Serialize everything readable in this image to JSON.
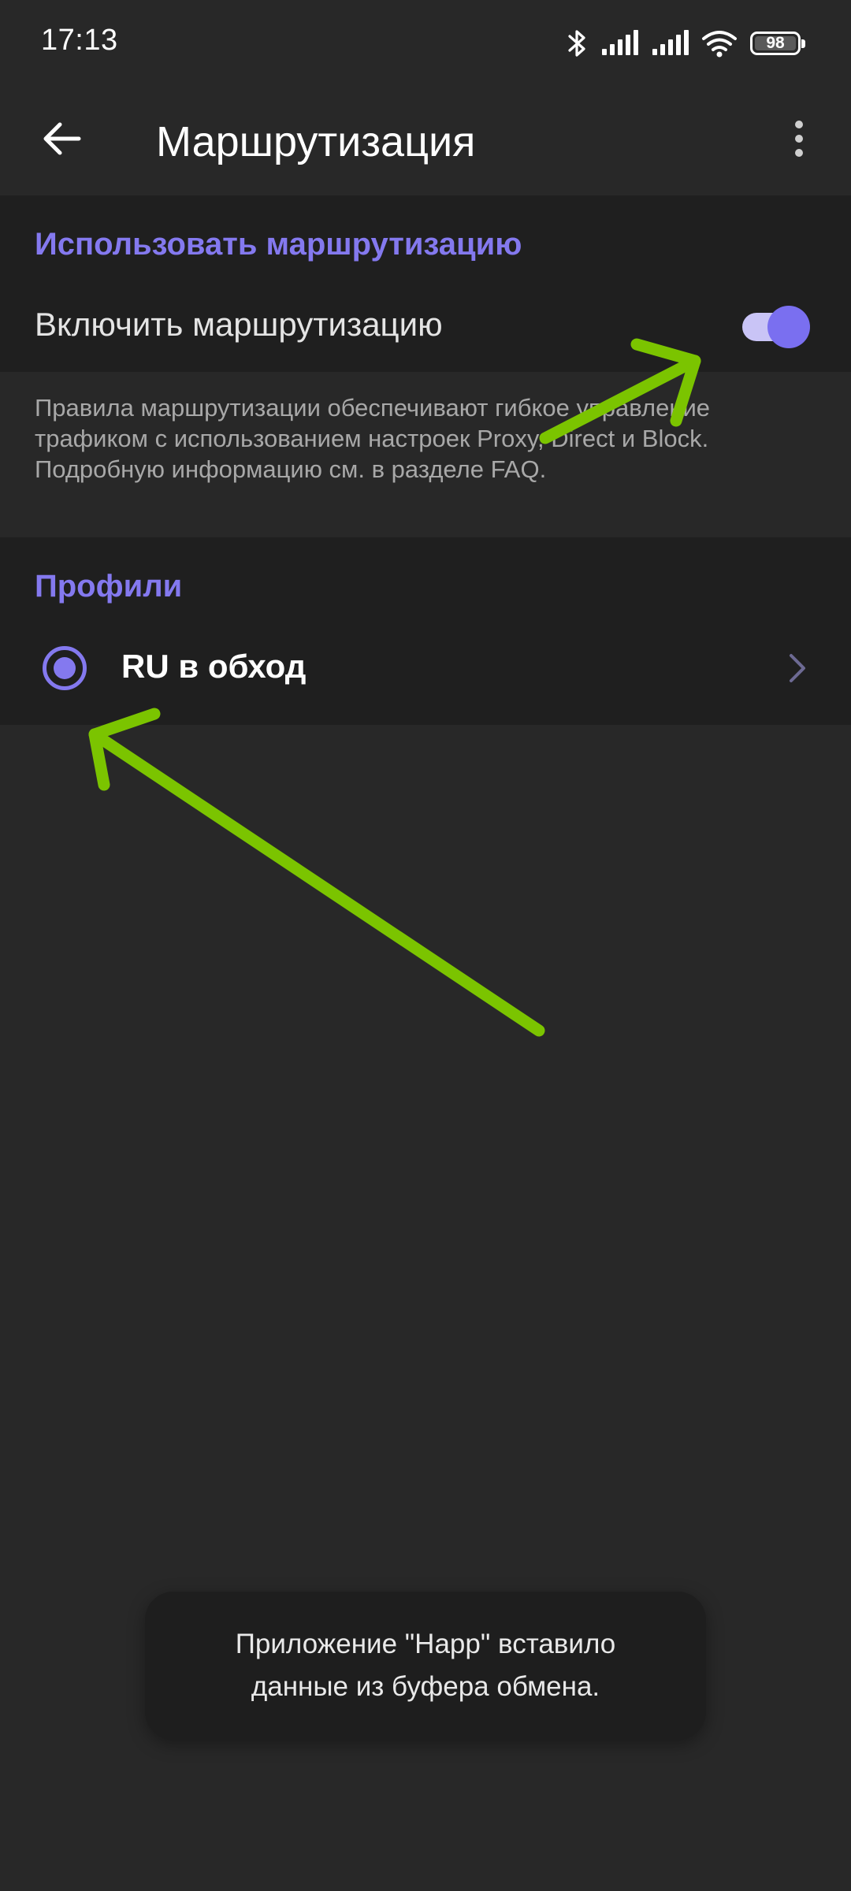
{
  "status_bar": {
    "time": "17:13",
    "battery": "98",
    "icons": [
      "bluetooth-icon",
      "signal-icon",
      "signal-icon",
      "wifi-icon",
      "battery-icon"
    ]
  },
  "app_bar": {
    "title": "Маршрутизация",
    "back_icon": "arrow-left-icon",
    "menu_icon": "more-vertical-icon"
  },
  "routing_section": {
    "header": "Использовать маршрутизацию",
    "toggle_label": "Включить маршрутизацию",
    "toggle_on": true,
    "description": "Правила маршрутизации обеспечивают гибкое управление трафиком с использованием настроек Proxy, Direct и Block. Подробную информацию см. в разделе FAQ."
  },
  "profiles_section": {
    "header": "Профили",
    "items": [
      {
        "name": "RU в обход",
        "selected": true
      }
    ]
  },
  "toast": {
    "line1": "Приложение \"Happ\" вставило",
    "line2": "данные из буфера обмена."
  },
  "colors": {
    "accent": "#8479ef",
    "annotation_arrow": "#7bc400",
    "background": "#282828",
    "card": "#1f1f1f"
  }
}
